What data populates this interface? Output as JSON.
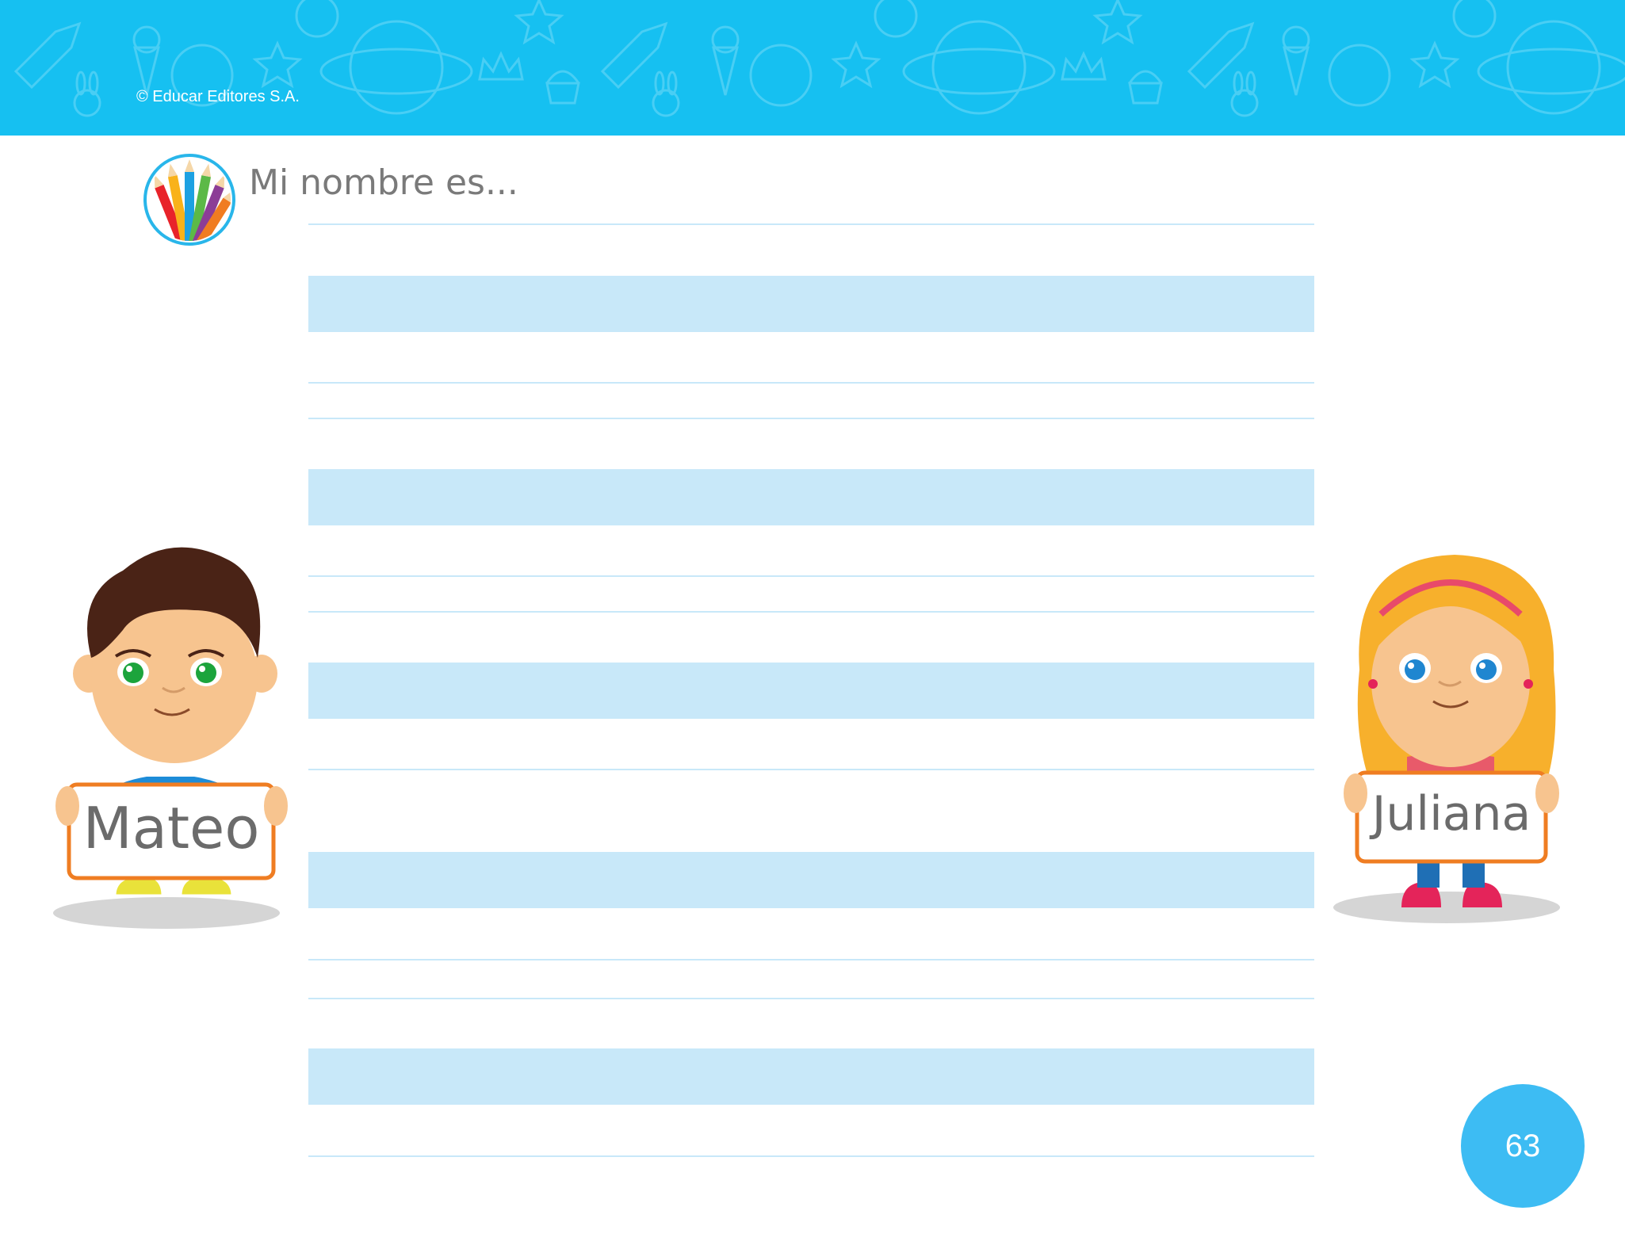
{
  "header": {
    "copyright": "© Educar Editores S.A."
  },
  "exercise": {
    "title": "Mi nombre es...",
    "icon": "colored-pencils-icon"
  },
  "characters": {
    "boy": {
      "name": "Mateo"
    },
    "girl": {
      "name": "Juliana"
    }
  },
  "page": {
    "number": "63"
  },
  "colors": {
    "banner": "#16c0f1",
    "writing_band": "#c8e8f9",
    "guide_line": "#c8e8f9",
    "page_circle": "#3dbcf3"
  }
}
